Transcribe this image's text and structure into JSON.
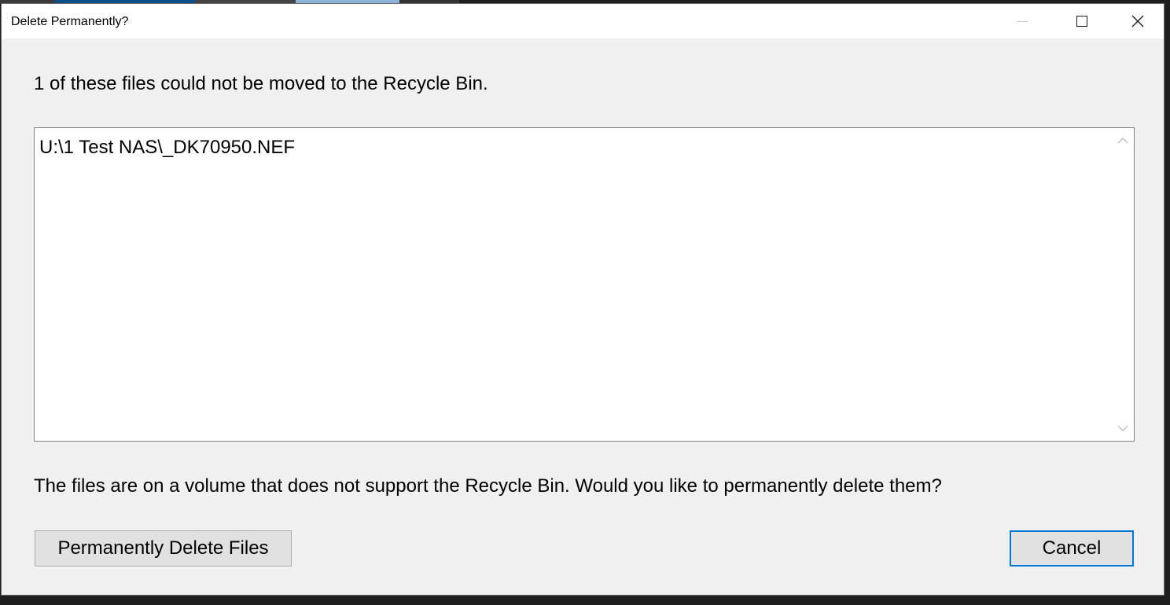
{
  "dialog": {
    "title": "Delete Permanently?",
    "message": "1 of these files could not be moved to the Recycle Bin.",
    "files": [
      "U:\\1 Test NAS\\_DK70950.NEF"
    ],
    "question": "The files are on a volume that does not support the Recycle Bin.  Would you like to permanently delete them?",
    "buttons": {
      "delete_label": "Permanently Delete Files",
      "cancel_label": "Cancel"
    },
    "title_buttons": {
      "minimize_icon": "minimize-icon",
      "maximize_icon": "maximize-icon",
      "close_icon": "close-icon"
    }
  },
  "colors": {
    "dialog_bg": "#f0f0f0",
    "titlebar_bg": "#ffffff",
    "focus_accent": "#0078d7",
    "button_bg": "#e1e1e1"
  }
}
